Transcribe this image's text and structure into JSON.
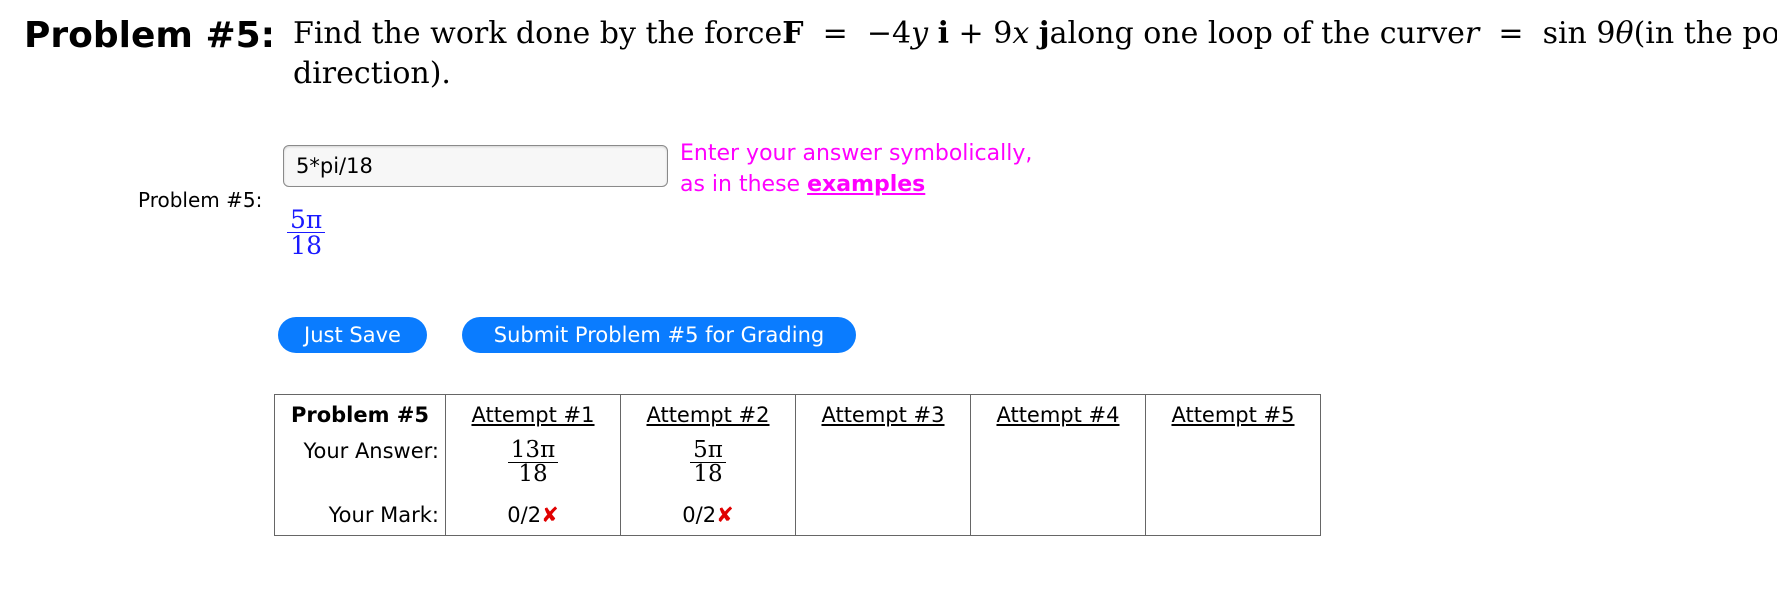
{
  "problem": {
    "heading": "Problem #5:",
    "text_intro": "Find the work done by the force",
    "force_F": "F",
    "force_eq": "=",
    "force_term1_coef": "−4",
    "force_term1_var": "y",
    "force_i": "i",
    "force_plus": "+",
    "force_term2_coef": "9",
    "force_term2_var": "x",
    "force_j": "j",
    "text_middle": "along one loop of the curve",
    "curve_r": "r",
    "curve_eq": "=",
    "curve_fn": "sin 9",
    "curve_theta": "θ",
    "text_end": "(in the positive",
    "line2": "direction)."
  },
  "side_label": "Problem #5:",
  "answer": {
    "value": "5*pi/18",
    "preview_num": "5π",
    "preview_den": "18"
  },
  "hint": {
    "line1": "Enter your answer symbolically,",
    "line2_prefix": "as in these ",
    "link": "examples"
  },
  "buttons": {
    "save": "Just Save",
    "submit": "Submit Problem #5 for Grading"
  },
  "attempts_table": {
    "corner": "Problem #5",
    "headers": [
      "Attempt #1",
      "Attempt #2",
      "Attempt #3",
      "Attempt #4",
      "Attempt #5"
    ],
    "answer_label": "Your Answer:",
    "mark_label": "Your Mark:",
    "answers": [
      {
        "num": "13π",
        "den": "18"
      },
      {
        "num": "5π",
        "den": "18"
      }
    ],
    "marks": [
      "0/2",
      "0/2"
    ],
    "mark_symbol": "✘"
  },
  "colors": {
    "button_blue": "#0a7cff",
    "hint_magenta": "#ff00ff",
    "preview_blue": "#1a1aff",
    "wrong_red": "#e00000"
  }
}
